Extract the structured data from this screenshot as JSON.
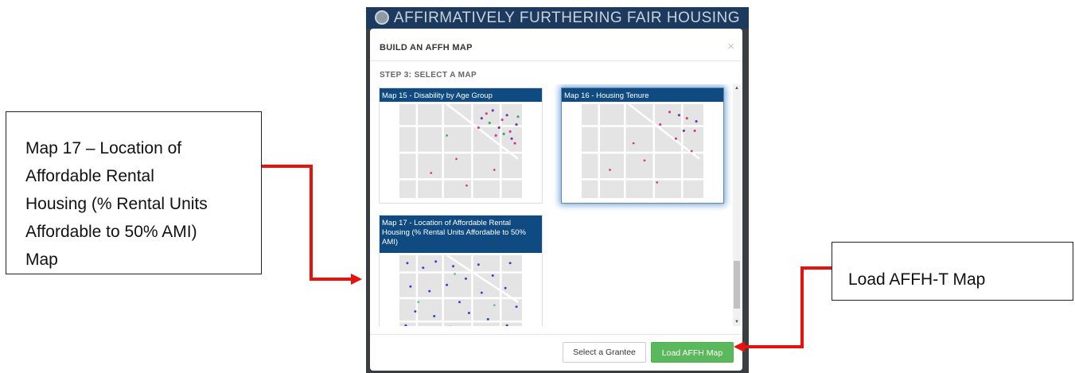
{
  "callouts": {
    "left_lines": [
      "Map 17 – Location of",
      "Affordable Rental",
      "Housing (% Rental Units",
      "Affordable to 50% AMI)",
      "Map"
    ],
    "right_text": "Load AFFH-T Map"
  },
  "app": {
    "header_title": "AFFIRMATIVELY FURTHERING FAIR HOUSING",
    "header_color": "#1c3a5e"
  },
  "modal": {
    "title": "BUILD AN AFFH MAP",
    "close_label": "×",
    "step_label": "STEP 3: SELECT A MAP",
    "cards": [
      {
        "title": "Map 15 - Disability by Age Group",
        "selected": false
      },
      {
        "title": "Map 16 - Housing Tenure",
        "selected": true
      },
      {
        "title": "Map 17 - Location of Affordable Rental Housing (% Rental Units Affordable to 50% AMI)",
        "selected": false
      }
    ],
    "buttons": {
      "select_grantee": "Select a Grantee",
      "load_map": "Load AFFH Map"
    }
  },
  "colors": {
    "card_header": "#0f4a80",
    "load_button": "#5cb85c",
    "arrow": "#e8120c"
  },
  "icons": {
    "seal": "hud-seal-icon",
    "close": "close-icon",
    "scroll_up": "chevron-up-icon",
    "scroll_down": "chevron-down-icon"
  }
}
